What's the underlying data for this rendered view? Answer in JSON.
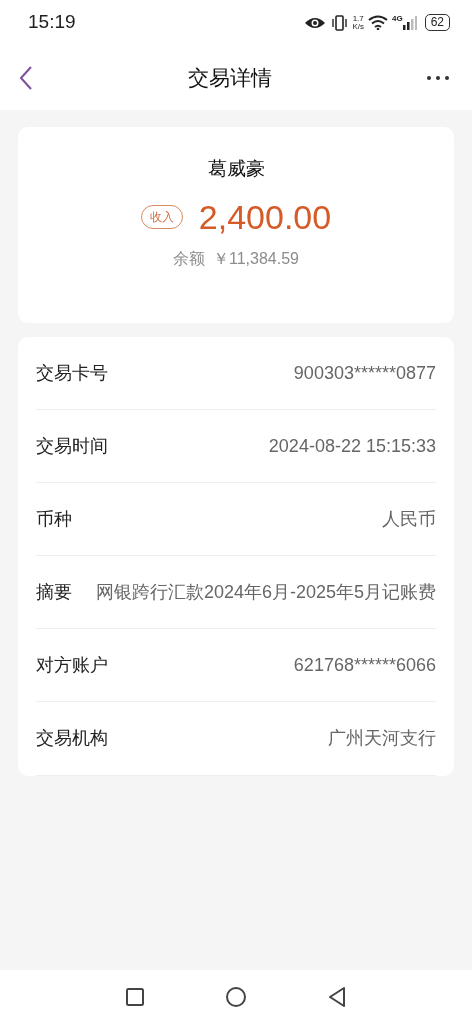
{
  "status_bar": {
    "time": "15:19",
    "speed_value": "1.7",
    "speed_unit": "K/s",
    "network": "4G",
    "battery": "62"
  },
  "header": {
    "title": "交易详情"
  },
  "summary": {
    "name": "葛威豪",
    "tag": "收入",
    "amount": "2,400.00",
    "balance_label": "余额",
    "balance": "￥11,384.59"
  },
  "details": [
    {
      "label": "交易卡号",
      "value": "900303******0877"
    },
    {
      "label": "交易时间",
      "value": "2024-08-22 15:15:33"
    },
    {
      "label": "币种",
      "value": "人民币"
    },
    {
      "label": "摘要",
      "value": "网银跨行汇款2024年6月-2025年5月记账费"
    },
    {
      "label": "对方账户",
      "value": "621768******6066"
    },
    {
      "label": "交易机构",
      "value": "广州天河支行"
    }
  ]
}
